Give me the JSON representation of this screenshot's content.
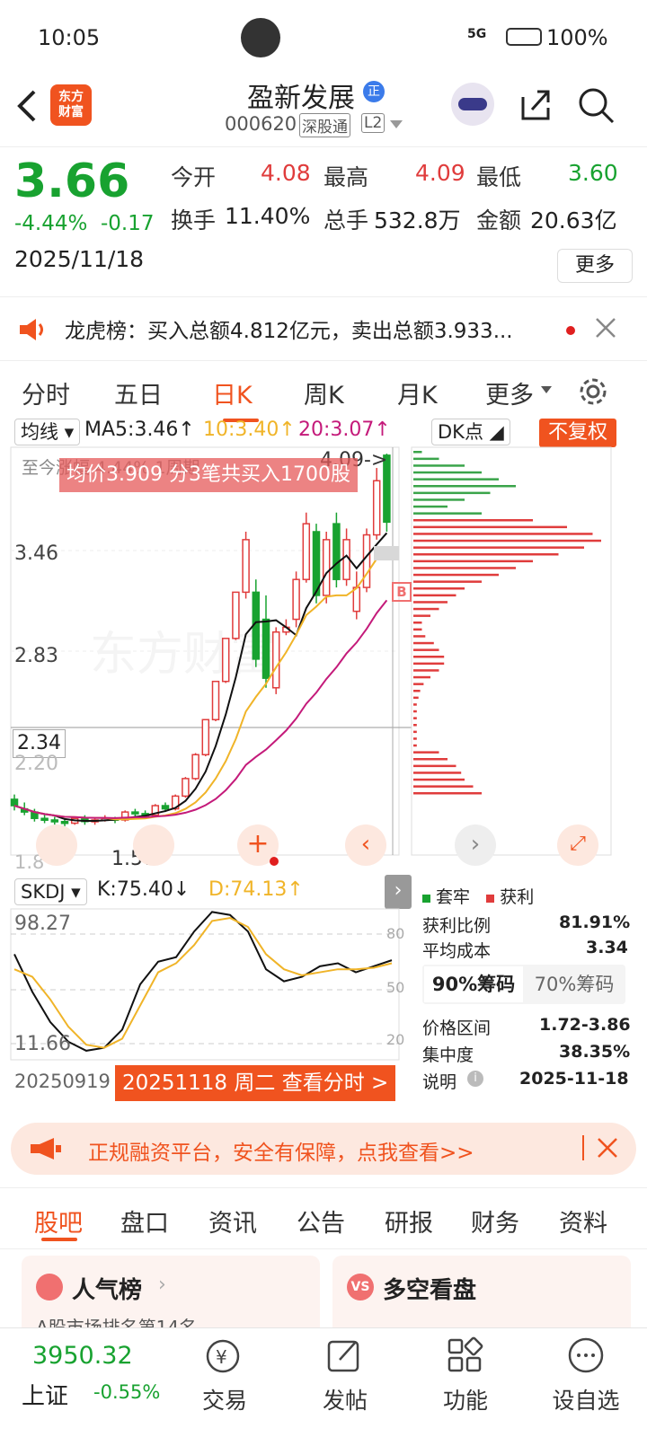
{
  "status": {
    "time": "10:05",
    "signal": "5G",
    "battery": "100%"
  },
  "header": {
    "title": "盈新发展",
    "code": "000620",
    "tag1": "深股通",
    "tag2": "L2",
    "logo": "东方\n财富"
  },
  "quote": {
    "price": "3.66",
    "pct": "-4.44%",
    "change": "-0.17",
    "date": "2025/11/18",
    "open_label": "今开",
    "open": "4.08",
    "high_label": "最高",
    "high": "4.09",
    "low_label": "最低",
    "low": "3.60",
    "turnover_label": "换手",
    "turnover": "11.40%",
    "volume_label": "总手",
    "volume": "532.8万",
    "amount_label": "金额",
    "amount": "20.63亿",
    "more": "更多"
  },
  "notice": {
    "text": "龙虎榜：买入总额4.812亿元，卖出总额3.933..."
  },
  "ktabs": [
    "分时",
    "五日",
    "日K",
    "周K",
    "月K",
    "更多"
  ],
  "chart": {
    "ma_select": "均线",
    "ma5": "MA5:3.46↑",
    "ma10": "10:3.40↑",
    "ma20": "20:3.07↑",
    "dk": "DK点",
    "fq": "不复权",
    "range_label": "至今涨幅 4.44% 1周期",
    "peak": "4.09->",
    "tooltip": "均价3.909 分3笔共买入1700股",
    "y1": "3.46",
    "y2": "2.83",
    "y3": "2.34",
    "y4": "2.20",
    "low_lbl": "1.57",
    "low_lbl2": "1.8",
    "b_marker": "B",
    "colors": {
      "up": "#e03c3c",
      "down": "#18a230",
      "ma5": "#111111",
      "ma10": "#f0b428",
      "ma20": "#c41a7a"
    }
  },
  "kdj": {
    "select": "SKDJ",
    "k": "K:75.40↓",
    "d": "D:74.13↑",
    "top": "98.27",
    "bottom": "11.66",
    "l80": "80",
    "l50": "50",
    "l20": "20",
    "start_date": "20250919",
    "pick": "20251118 周二 查看分时 >"
  },
  "chips": {
    "legend_trap": "套牢",
    "legend_profit": "获利",
    "rows": [
      {
        "k": "获利比例",
        "v": "81.91%"
      },
      {
        "k": "平均成本",
        "v": "3.34"
      }
    ],
    "tab90": "90%筹码",
    "tab70": "70%筹码",
    "rows2": [
      {
        "k": "价格区间",
        "v": "1.72-3.86"
      },
      {
        "k": "集中度",
        "v": "38.35%"
      },
      {
        "k": "说明",
        "v": "2025-11-18"
      }
    ]
  },
  "banner": {
    "text": "正规融资平台，安全有保障，点我查看>>"
  },
  "btabs": [
    "股吧",
    "盘口",
    "资讯",
    "公告",
    "研报",
    "财务",
    "资料"
  ],
  "cards": {
    "left": "人气榜",
    "left_sub": "A股市场排名第14名",
    "right": "多空看盘"
  },
  "nav": {
    "index_value": "3950.32",
    "index_name": "上证",
    "index_pct": "-0.55%",
    "items": [
      "交易",
      "发帖",
      "功能",
      "设自选"
    ]
  }
}
